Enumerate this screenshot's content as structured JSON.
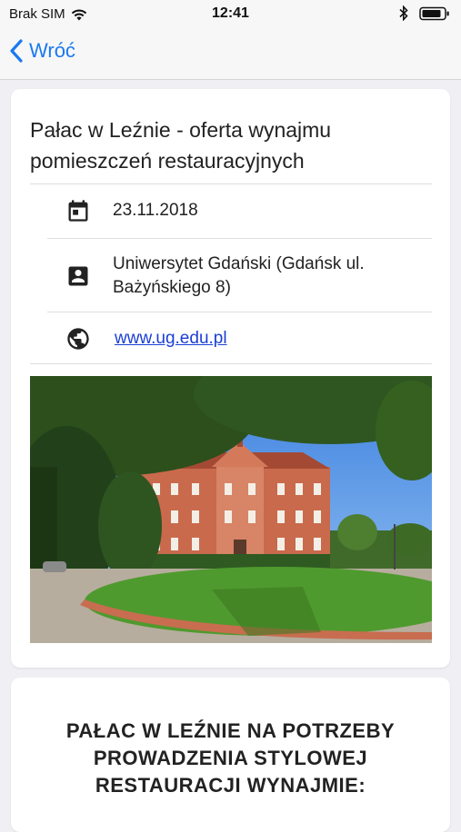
{
  "status_bar": {
    "carrier": "Brak SIM",
    "time": "12:41",
    "icons": [
      "wifi-icon",
      "bluetooth-icon",
      "battery-icon"
    ]
  },
  "nav": {
    "back_label": "Wróć",
    "accent_color": "#1a7af0"
  },
  "event": {
    "title": "Pałac w Leźnie - oferta wynajmu pomieszczeń restauracyjnych",
    "date": "23.11.2018",
    "organizer": "Uniwersytet Gdański (Gdańsk ul. Bażyńskiego 8)",
    "website": "www.ug.edu.pl",
    "icons": [
      "calendar-icon",
      "contact-card-icon",
      "globe-icon"
    ]
  },
  "description": {
    "heading": "PAŁAC W LEŹNIE NA POTRZEBY PROWADZENIA STYLOWEJ RESTAURACJI WYNAJMIE:"
  }
}
